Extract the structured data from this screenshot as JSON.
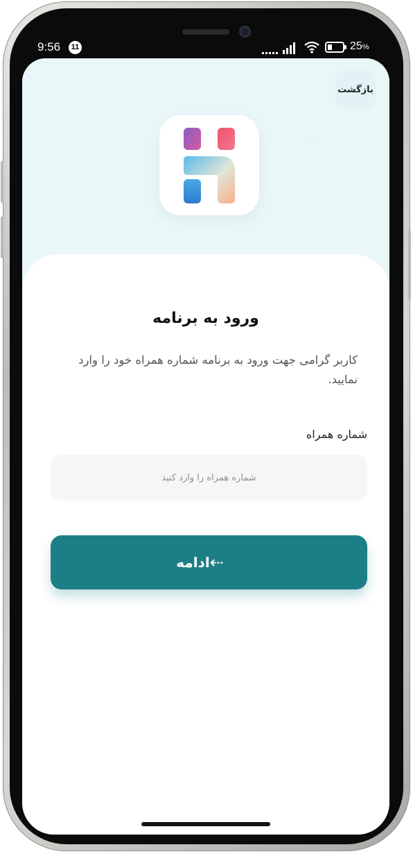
{
  "status_bar": {
    "time": "9:56",
    "notification_count": "11",
    "battery_percent": "25",
    "battery_percent_sign": "%"
  },
  "header": {
    "back_label": "بازگشت",
    "dots": "◦ ◦"
  },
  "login": {
    "title": "ورود به برنامه",
    "description": "کاربر گرامی جهت ورود به برنامه شماره همراه خود را وارد نمایید.",
    "phone_label": "شماره همراه",
    "phone_placeholder": "شماره همراه را وارد کنید",
    "phone_value": "",
    "continue_label": "ادامه",
    "continue_arrow": "⇠"
  },
  "colors": {
    "accent": "#1d7f86",
    "hero_background": "#e9f7f9",
    "input_background": "#f6f6f6"
  },
  "icons": [
    "wifi-icon",
    "signal-icon",
    "battery-icon",
    "arrow-left-icon",
    "app-logo-icon"
  ]
}
